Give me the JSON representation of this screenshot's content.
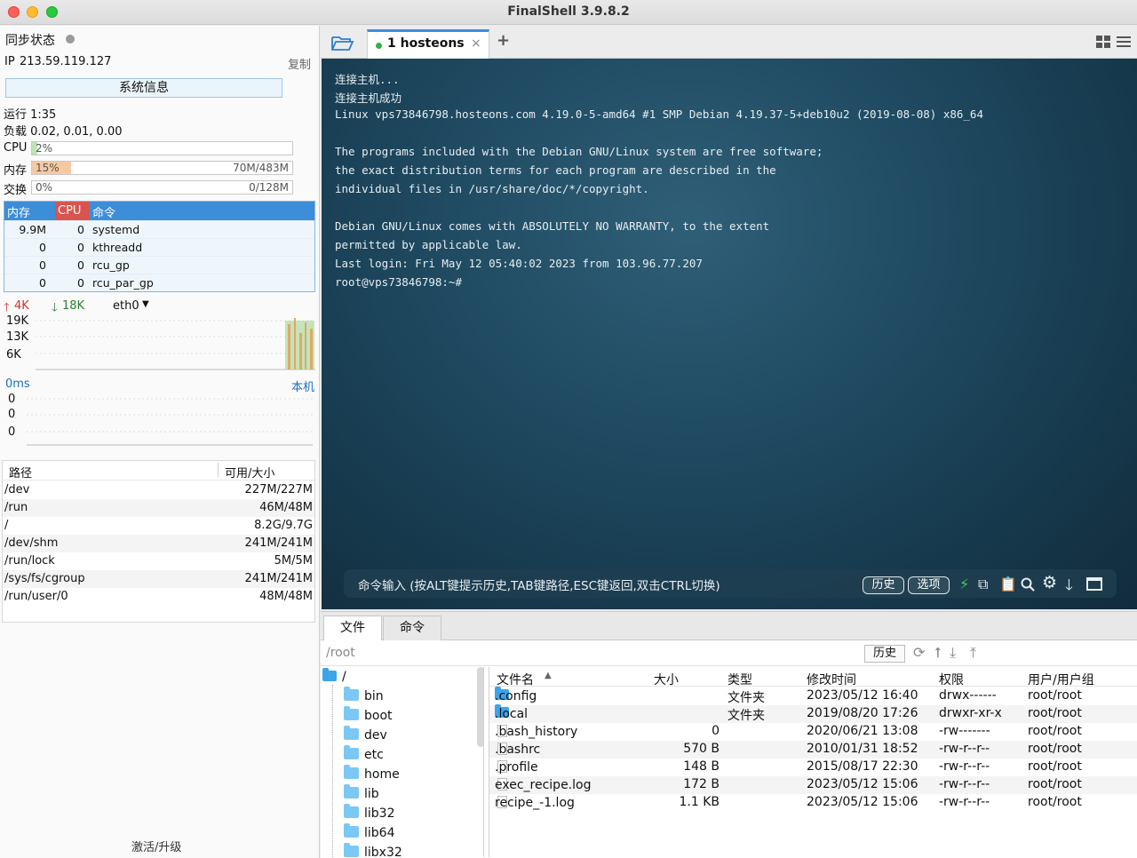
{
  "window": {
    "title": "FinalShell 3.9.8.2"
  },
  "sidebar": {
    "sync_label": "同步状态",
    "ip_label": "IP",
    "ip_value": "213.59.119.127",
    "copy_label": "复制",
    "sysinfo_button": "系统信息",
    "uptime": "运行 1:35",
    "load": "负载 0.02, 0.01, 0.00",
    "cpu": {
      "label": "CPU",
      "value": "2%",
      "fraction": 0.02
    },
    "mem": {
      "label": "内存",
      "value": "15%",
      "detail": "70M/483M",
      "fraction": 0.15
    },
    "swap": {
      "label": "交换",
      "value": "0%",
      "detail": "0/128M",
      "fraction": 0
    },
    "proc_headers": [
      "内存",
      "CPU",
      "命令"
    ],
    "processes": [
      {
        "mem": "9.9M",
        "cpu": "0",
        "cmd": "systemd"
      },
      {
        "mem": "0",
        "cpu": "0",
        "cmd": "kthreadd"
      },
      {
        "mem": "0",
        "cpu": "0",
        "cmd": "rcu_gp"
      },
      {
        "mem": "0",
        "cpu": "0",
        "cmd": "rcu_par_gp"
      }
    ],
    "net": {
      "up": "4K",
      "down": "18K",
      "iface": "eth0",
      "ticks": [
        "19K",
        "13K",
        "6K"
      ]
    },
    "ping": {
      "latency": "0ms",
      "target": "本机",
      "ticks": [
        "0",
        "0",
        "0"
      ]
    },
    "disk_headers": [
      "路径",
      "可用/大小"
    ],
    "disks": [
      {
        "path": "/dev",
        "size": "227M/227M"
      },
      {
        "path": "/run",
        "size": "46M/48M"
      },
      {
        "path": "/",
        "size": "8.2G/9.7G"
      },
      {
        "path": "/dev/shm",
        "size": "241M/241M"
      },
      {
        "path": "/run/lock",
        "size": "5M/5M"
      },
      {
        "path": "/sys/fs/cgroup",
        "size": "241M/241M"
      },
      {
        "path": "/run/user/0",
        "size": "48M/48M"
      }
    ],
    "activate_label": "激活/升级"
  },
  "tabs": {
    "session": "1 hosteons",
    "add": "+",
    "close": "×"
  },
  "terminal": {
    "lines": [
      "连接主机...",
      "连接主机成功",
      "Linux vps73846798.hosteons.com 4.19.0-5-amd64 #1 SMP Debian 4.19.37-5+deb10u2 (2019-08-08) x86_64",
      "",
      "The programs included with the Debian GNU/Linux system are free software;",
      "the exact distribution terms for each program are described in the",
      "individual files in /usr/share/doc/*/copyright.",
      "",
      "Debian GNU/Linux comes with ABSOLUTELY NO WARRANTY, to the extent",
      "permitted by applicable law.",
      "Last login: Fri May 12 05:40:02 2023 from 103.96.77.207",
      "root@vps73846798:~#"
    ],
    "command_placeholder": "命令输入 (按ALT键提示历史,TAB键路径,ESC键返回,双击CTRL切换)",
    "history_button": "历史",
    "options_button": "选项"
  },
  "files": {
    "tab_files": "文件",
    "tab_commands": "命令",
    "path": "/root",
    "history_button": "历史",
    "tree": [
      "/",
      "bin",
      "boot",
      "dev",
      "etc",
      "home",
      "lib",
      "lib32",
      "lib64",
      "libx32"
    ],
    "headers": [
      "文件名",
      "大小",
      "类型",
      "修改时间",
      "权限",
      "用户/用户组"
    ],
    "rows": [
      {
        "name": ".config",
        "size": "",
        "type": "文件夹",
        "mtime": "2023/05/12 16:40",
        "perm": "drwx------",
        "owner": "root/root",
        "folder": true
      },
      {
        "name": ".local",
        "size": "",
        "type": "文件夹",
        "mtime": "2019/08/20 17:26",
        "perm": "drwxr-xr-x",
        "owner": "root/root",
        "folder": true
      },
      {
        "name": ".bash_history",
        "size": "0",
        "type": "",
        "mtime": "2020/06/21 13:08",
        "perm": "-rw-------",
        "owner": "root/root",
        "folder": false
      },
      {
        "name": ".bashrc",
        "size": "570 B",
        "type": "",
        "mtime": "2010/01/31 18:52",
        "perm": "-rw-r--r--",
        "owner": "root/root",
        "folder": false
      },
      {
        "name": ".profile",
        "size": "148 B",
        "type": "",
        "mtime": "2015/08/17 22:30",
        "perm": "-rw-r--r--",
        "owner": "root/root",
        "folder": false
      },
      {
        "name": "exec_recipe.log",
        "size": "172 B",
        "type": "",
        "mtime": "2023/05/12 15:06",
        "perm": "-rw-r--r--",
        "owner": "root/root",
        "folder": false
      },
      {
        "name": "recipe_-1.log",
        "size": "1.1 KB",
        "type": "",
        "mtime": "2023/05/12 15:06",
        "perm": "-rw-r--r--",
        "owner": "root/root",
        "folder": false
      }
    ]
  },
  "colors": {
    "accent": "#3d8ed8",
    "mem_fill": "#f6c9a3",
    "cpu_fill": "#bfe3b4",
    "net_up": "#c0392b",
    "net_down": "#2e7d32"
  }
}
